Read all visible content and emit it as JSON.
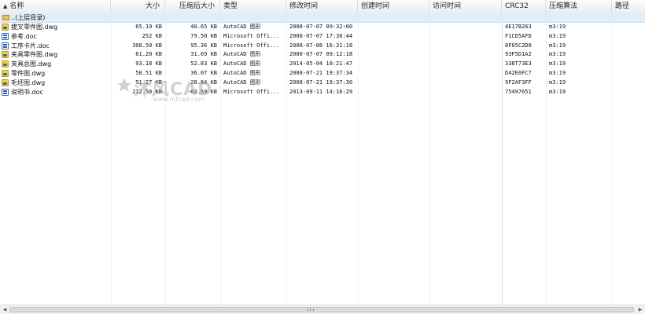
{
  "columns": [
    {
      "label": "名称",
      "align": "left"
    },
    {
      "label": "大小",
      "align": "right"
    },
    {
      "label": "压缩后大小",
      "align": "right"
    },
    {
      "label": "类型",
      "align": "left"
    },
    {
      "label": "修改时间",
      "align": "left"
    },
    {
      "label": "创建时间",
      "align": "left"
    },
    {
      "label": "访问时间",
      "align": "left"
    },
    {
      "label": "CRC32",
      "align": "left"
    },
    {
      "label": "压缩算法",
      "align": "left"
    },
    {
      "label": "路径",
      "align": "left"
    }
  ],
  "parent_row": {
    "label": "..(上层目录)"
  },
  "files": [
    {
      "name": "拔叉零件图.dwg",
      "icon": "dwg-file-icon",
      "size": "65.19 KB",
      "packed": "40.65 KB",
      "type": "AutoCAD 图形",
      "modified": "2008-07-07 09:32:00",
      "created": "",
      "accessed": "",
      "crc": "4E17B263",
      "method": "m3:19",
      "path": ""
    },
    {
      "name": "参考.doc",
      "icon": "doc-file-icon",
      "size": "252 KB",
      "packed": "79.50 KB",
      "type": "Microsoft Offi...",
      "modified": "2008-07-07 17:36:44",
      "created": "",
      "accessed": "",
      "crc": "F1CD5AFD",
      "method": "m3:19",
      "path": ""
    },
    {
      "name": "工序卡片.doc",
      "icon": "doc-file-icon",
      "size": "308.50 KB",
      "packed": "95.36 KB",
      "type": "Microsoft Offi...",
      "modified": "2008-07-08 16:31:18",
      "created": "",
      "accessed": "",
      "crc": "8F65C2D0",
      "method": "m3:19",
      "path": ""
    },
    {
      "name": "夹具零件图.dwg",
      "icon": "dwg-file-icon",
      "size": "61.20 KB",
      "packed": "31.69 KB",
      "type": "AutoCAD 图形",
      "modified": "2000-07-07 09:12:18",
      "created": "",
      "accessed": "",
      "crc": "93F5D1A2",
      "method": "m3:19",
      "path": ""
    },
    {
      "name": "夹具总图.dwg",
      "icon": "dwg-file-icon",
      "size": "93.18 KB",
      "packed": "52.83 KB",
      "type": "AutoCAD 图形",
      "modified": "2014-05-04 10:21:47",
      "created": "",
      "accessed": "",
      "crc": "338T73E3",
      "method": "m3:19",
      "path": ""
    },
    {
      "name": "零件图.dwg",
      "icon": "dwg-file-icon",
      "size": "58.51 KB",
      "packed": "36.07 KB",
      "type": "AutoCAD 图形",
      "modified": "2008-07-21 19:37:34",
      "created": "",
      "accessed": "",
      "crc": "D42E0FC7",
      "method": "m3:19",
      "path": ""
    },
    {
      "name": "毛坯图.dwg",
      "icon": "dwg-file-icon",
      "size": "51.27 KB",
      "packed": "28.84 KB",
      "type": "AutoCAD 图形",
      "modified": "2008-07-21 19:37:30",
      "created": "",
      "accessed": "",
      "crc": "9F2AF3FF",
      "method": "m3:19",
      "path": ""
    },
    {
      "name": "说明书.doc",
      "icon": "doc-file-icon",
      "size": "212.50 KB",
      "packed": "63.59 KB",
      "type": "Microsoft Offi...",
      "modified": "2013-09-11 14:16:29",
      "created": "",
      "accessed": "",
      "crc": "75497651",
      "method": "m3:19",
      "path": ""
    }
  ],
  "watermark": {
    "main": "沐风CAD",
    "sub": "www.mfcad.com"
  },
  "scrollbar": {
    "left_arrow": "◀",
    "right_arrow": "▶"
  }
}
